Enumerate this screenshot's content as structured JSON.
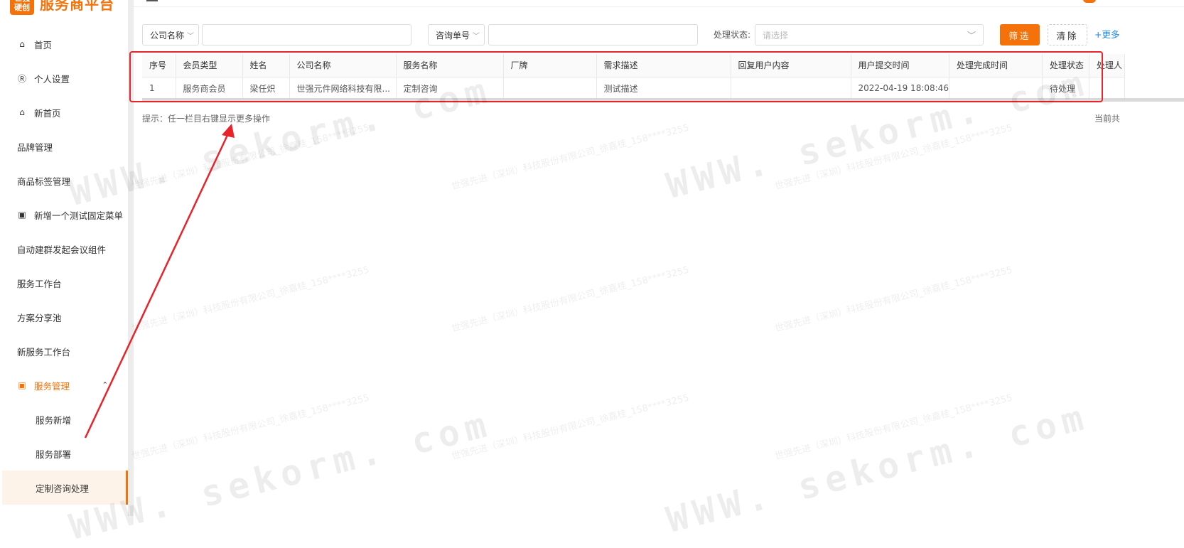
{
  "logo": {
    "mark_top": "世强",
    "mark_bottom": "硬创",
    "text": "服务商平台"
  },
  "sidebar": {
    "items": [
      {
        "label": "首页",
        "icon": "home-icon",
        "glyph": "⌂"
      },
      {
        "label": "个人设置",
        "icon": "user-icon",
        "glyph": "Ⓡ"
      },
      {
        "label": "新首页",
        "icon": "home-icon",
        "glyph": "⌂"
      },
      {
        "label": "品牌管理"
      },
      {
        "label": "商品标签管理"
      },
      {
        "label": "新增一个测试固定菜单",
        "icon": "menu-icon",
        "glyph": "▣"
      },
      {
        "label": "自动建群发起会议组件"
      },
      {
        "label": "服务工作台"
      },
      {
        "label": "方案分享池"
      },
      {
        "label": "新服务工作台"
      },
      {
        "label": "服务管理",
        "icon": "menu-icon",
        "glyph": "▣",
        "open": true
      },
      {
        "label": "服务新增",
        "sub": true
      },
      {
        "label": "服务部署",
        "sub": true
      },
      {
        "label": "定制咨询处理",
        "sub": true,
        "active": true
      }
    ],
    "caret_glyph": "⌃"
  },
  "filters": {
    "company_select": "公司名称",
    "company_value": "",
    "order_select": "咨询单号",
    "order_value": "",
    "status_label": "处理状态:",
    "status_placeholder": "请选择",
    "filter_button": "筛选",
    "clear_button": "清除",
    "more_link": "+更多"
  },
  "table": {
    "columns": [
      "序号",
      "会员类型",
      "姓名",
      "公司名称",
      "服务名称",
      "厂牌",
      "需求描述",
      "回复用户内容",
      "用户提交时间",
      "处理完成时间",
      "处理状态",
      "处理人"
    ],
    "rows": [
      [
        "1",
        "服务商会员",
        "梁任炽",
        "世强元件网络科技有限...",
        "定制咨询",
        "",
        "测试描述",
        "",
        "2022-04-19 18:08:46",
        "",
        "待处理",
        ""
      ]
    ]
  },
  "hint": "提示：任一栏目右键显示更多操作",
  "page_info": "当前共",
  "colors": {
    "accent": "#f5720a",
    "annotation": "#e8232a",
    "link": "#1e88e5"
  }
}
